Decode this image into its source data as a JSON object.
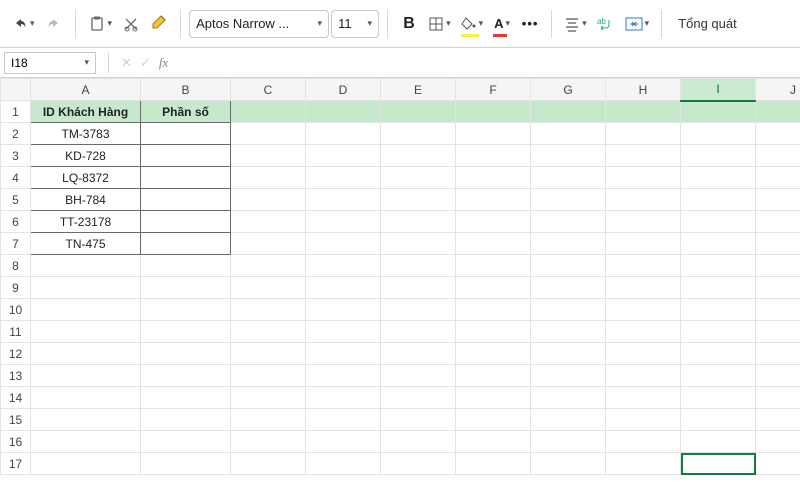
{
  "toolbar": {
    "font_name": "Aptos Narrow ...",
    "font_size": "11",
    "view_label": "Tổng quát"
  },
  "formula_bar": {
    "cell_ref": "I18",
    "cancel": "✕",
    "confirm": "✓",
    "fx": "fx"
  },
  "columns": [
    "A",
    "B",
    "C",
    "D",
    "E",
    "F",
    "G",
    "H",
    "I",
    "J"
  ],
  "row_count": 17,
  "active_column": "I",
  "selected_cell_row": 17,
  "headers": {
    "a1": "ID Khách Hàng",
    "b1": "Phần số"
  },
  "data_rows": [
    {
      "a": "TM-3783"
    },
    {
      "a": "KD-728"
    },
    {
      "a": "LQ-8372"
    },
    {
      "a": "BH-784"
    },
    {
      "a": "TT-23178"
    },
    {
      "a": "TN-475"
    }
  ]
}
